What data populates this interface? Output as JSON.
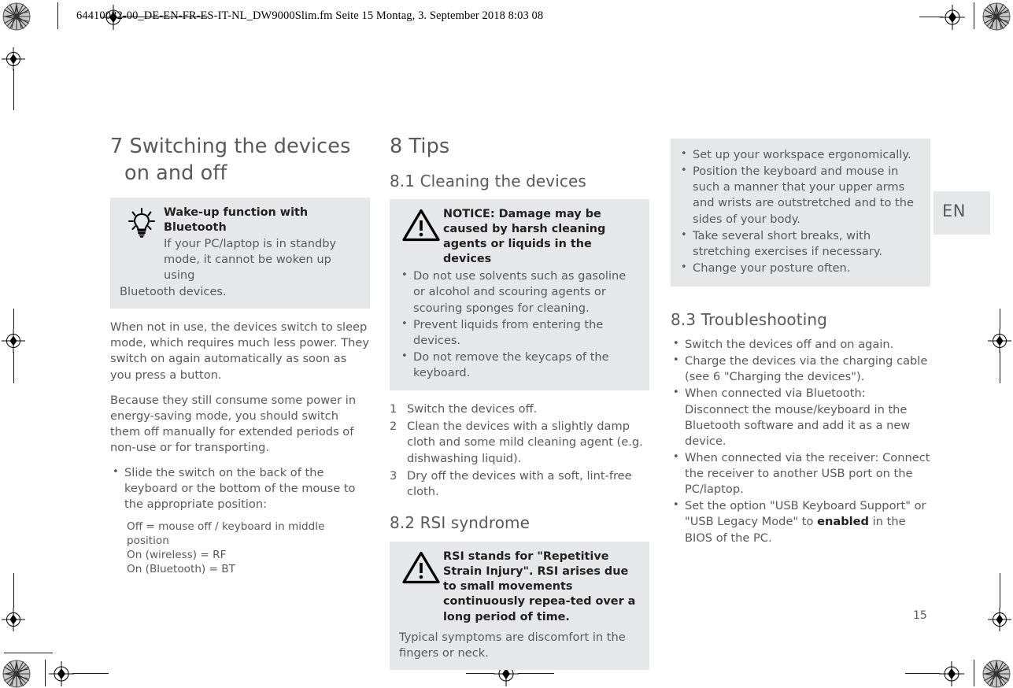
{
  "header": {
    "slug": "64410032-00_DE-EN-FR-ES-IT-NL_DW9000Slim.fm  Seite 15  Montag, 3. September 2018  8:03 08"
  },
  "lang_tab": {
    "label": "EN"
  },
  "folio": {
    "page_number": "15"
  },
  "colors": {
    "box_gray": "#e6e7e8",
    "body_text": "#58595b",
    "heading_text": "#58595b",
    "bold_text": "#231f20"
  },
  "column1": {
    "heading_line1": "7 Switching the devices",
    "heading_line2": "on and off",
    "tip_box": {
      "icon": "lightbulb-icon",
      "title": "Wake-up function with Bluetooth",
      "text": "If your PC/laptop is in standby mode, it cannot be woken up using",
      "text_after": "Bluetooth devices."
    },
    "paragraph1": "When not in use, the devices switch to sleep mode, which requires much less power. They switch on again automatically as soon as you press a button.",
    "paragraph2": "Because they still consume some power in energy-saving mode, you should switch them off manually for extended periods of non-use or for transporting.",
    "bullets": [
      "Slide the switch on the back of the keyboard or the bottom of the mouse to the appropriate position:"
    ],
    "switch_positions": [
      "Off = mouse off / keyboard in middle position",
      "On (wireless) = RF",
      "On (Bluetooth) = BT"
    ]
  },
  "column2": {
    "heading": "8 Tips",
    "subheading_1": "8.1 Cleaning the devices",
    "notice_box": {
      "icon": "warning-triangle-icon",
      "title": "NOTICE: Damage may be caused by harsh cleaning agents or liquids in the devices",
      "bullets": [
        "Do not use solvents such as gasoline or alcohol and scouring agents or scouring sponges for cleaning.",
        "Prevent liquids from entering the devices.",
        "Do not remove the keycaps of the keyboard."
      ]
    },
    "steps": [
      {
        "num": "1",
        "text": "Switch the devices off."
      },
      {
        "num": "2",
        "text": "Clean the devices with a slightly damp cloth and some mild cleaning agent (e.g. dishwashing liquid)."
      },
      {
        "num": "3",
        "text": "Dry off the devices with a soft, lint-free cloth."
      }
    ],
    "subheading_2": "8.2 RSI syndrome",
    "rsi_box": {
      "icon": "warning-triangle-icon",
      "title": "RSI stands for \"Repetitive Strain Injury\". RSI arises due to small movements continuously repea-ted over a long period of time.",
      "text_after": "Typical symptoms are discomfort in the fingers or neck."
    }
  },
  "column3": {
    "ergonomics_box": {
      "bullets": [
        "Set up your workspace ergonomically.",
        "Position the keyboard and mouse in such a manner that your upper arms and wrists are outstretched and to the sides of your body.",
        "Take several short breaks, with stretching exercises if necessary.",
        "Change your posture often."
      ]
    },
    "subheading": "8.3 Troubleshooting",
    "bullets": [
      "Switch the devices off and on again.",
      "Charge the devices via the charging cable (see 6 \"Charging the devices\").",
      "When connected via Bluetooth: Disconnect the mouse/keyboard in the Bluetooth software and add it as a new device.",
      "When connected via the receiver: Connect the receiver to another USB port on the PC/laptop."
    ],
    "bullet_bios_pre": "Set the option \"USB Keyboard Support\" or \"USB Legacy Mode\" to ",
    "bullet_bios_bold": "enabled",
    "bullet_bios_post": " in the BIOS of the PC."
  }
}
